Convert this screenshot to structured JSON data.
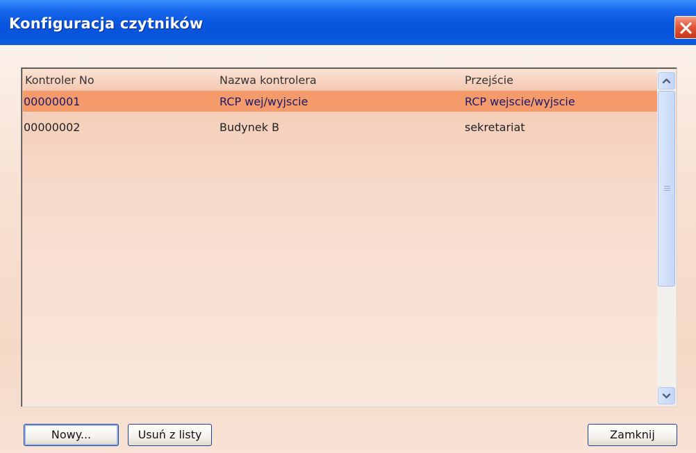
{
  "window": {
    "title": "Konfiguracja czytników"
  },
  "list": {
    "columns": [
      "Kontroler No",
      "Nazwa kontrolera",
      "Przejście"
    ],
    "rows": [
      [
        "00000001",
        "RCP wej/wyjscie",
        "RCP wejscie/wyjscie"
      ],
      [
        "00000002",
        "Budynek B",
        "sekretariat"
      ]
    ],
    "selected_row": 0
  },
  "buttons": {
    "new": "Nowy...",
    "remove": "Usuń z listy",
    "close": "Zamknij"
  },
  "icons": {
    "close": "close-icon",
    "scroll_up": "chevron-up-icon",
    "scroll_down": "chevron-down-icon"
  },
  "colors": {
    "titlebar": "#0753d9",
    "selection": "#f59a6a",
    "client_bg": "#f8e1d2"
  }
}
